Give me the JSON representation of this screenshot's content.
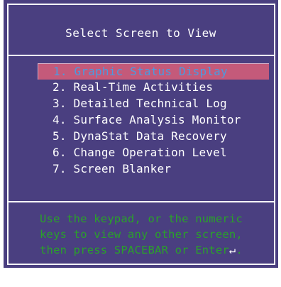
{
  "window": {
    "title": "Select Screen to View"
  },
  "menu": {
    "items": [
      {
        "label": "1. Graphic Status Display",
        "selected": true
      },
      {
        "label": "2. Real-Time Activities",
        "selected": false
      },
      {
        "label": "3. Detailed Technical Log",
        "selected": false
      },
      {
        "label": "4. Surface Analysis Monitor",
        "selected": false
      },
      {
        "label": "5. DynaStat Data Recovery",
        "selected": false
      },
      {
        "label": "6. Change Operation Level",
        "selected": false
      },
      {
        "label": "7. Screen Blanker",
        "selected": false
      }
    ]
  },
  "hint": {
    "line1": "Use the keypad, or the numeric",
    "line2": "keys to view any other screen,",
    "line3_prefix": "then press SPACEBAR or Enter",
    "enter_glyph": "↵",
    "line3_suffix": "."
  },
  "colors": {
    "background": "#4a3f80",
    "selected_bg": "#c45a7a",
    "selected_text": "#4a9be0",
    "hint_text": "#2aa12a"
  }
}
